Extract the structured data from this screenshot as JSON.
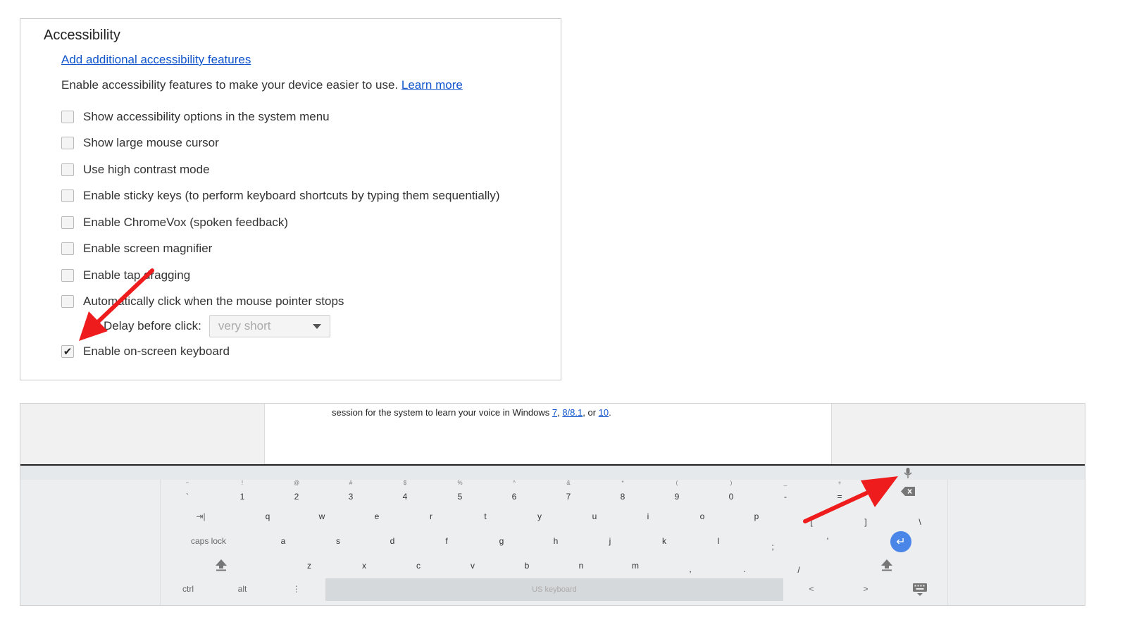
{
  "accessibility": {
    "title": "Accessibility",
    "add_link": "Add additional accessibility features",
    "description": "Enable accessibility features to make your device easier to use.",
    "learn_more": "Learn more",
    "options": [
      {
        "label": "Show accessibility options in the system menu",
        "checked": false
      },
      {
        "label": "Show large mouse cursor",
        "checked": false
      },
      {
        "label": "Use high contrast mode",
        "checked": false
      },
      {
        "label": "Enable sticky keys (to perform keyboard shortcuts by typing them sequentially)",
        "checked": false
      },
      {
        "label": "Enable ChromeVox (spoken feedback)",
        "checked": false
      },
      {
        "label": "Enable screen magnifier",
        "checked": false
      },
      {
        "label": "Enable tap dragging",
        "checked": false
      },
      {
        "label": "Automatically click when the mouse pointer stops",
        "checked": false
      }
    ],
    "delay_label": "Delay before click:",
    "delay_value": "very short",
    "onscreen_option": {
      "label": "Enable on-screen keyboard",
      "checked": true
    }
  },
  "document": {
    "text_before": "session for the system to learn your voice in Windows ",
    "link1": "7",
    "sep1": ", ",
    "link2": "8/8.1",
    "sep2": ", or ",
    "link3": "10",
    "end": "."
  },
  "keyboard": {
    "number_row": [
      {
        "main": "`",
        "sub": "~"
      },
      {
        "main": "1",
        "sub": "!"
      },
      {
        "main": "2",
        "sub": "@"
      },
      {
        "main": "3",
        "sub": "#"
      },
      {
        "main": "4",
        "sub": "$"
      },
      {
        "main": "5",
        "sub": "%"
      },
      {
        "main": "6",
        "sub": "^"
      },
      {
        "main": "7",
        "sub": "&"
      },
      {
        "main": "8",
        "sub": "*"
      },
      {
        "main": "9",
        "sub": "("
      },
      {
        "main": "0",
        "sub": ")"
      },
      {
        "main": "-",
        "sub": "_"
      },
      {
        "main": "=",
        "sub": "+"
      }
    ],
    "tab_label": "⇥|",
    "qwerty_row": [
      "q",
      "w",
      "e",
      "r",
      "t",
      "y",
      "u",
      "i",
      "o",
      "p",
      "[",
      "]",
      "\\"
    ],
    "caps_label": "caps lock",
    "home_row": [
      "a",
      "s",
      "d",
      "f",
      "g",
      "h",
      "j",
      "k",
      "l",
      ";",
      "'"
    ],
    "bottom_row": [
      "z",
      "x",
      "c",
      "v",
      "b",
      "n",
      "m",
      ",",
      ".",
      "/"
    ],
    "ctrl_label": "ctrl",
    "alt_label": "alt",
    "more_label": "⋮",
    "space_label": "US keyboard",
    "left_label": "<",
    "right_label": ">",
    "enter_symbol": "↵"
  },
  "icons": {
    "mic": "microphone-icon",
    "backspace": "backspace-icon",
    "shift": "shift-icon",
    "hide": "keyboard-hide-icon",
    "arrow": "red-pointer-arrow"
  },
  "colors": {
    "link": "#1155cc",
    "arrow": "#ee1c1c",
    "enter_key": "#4a86e8"
  }
}
